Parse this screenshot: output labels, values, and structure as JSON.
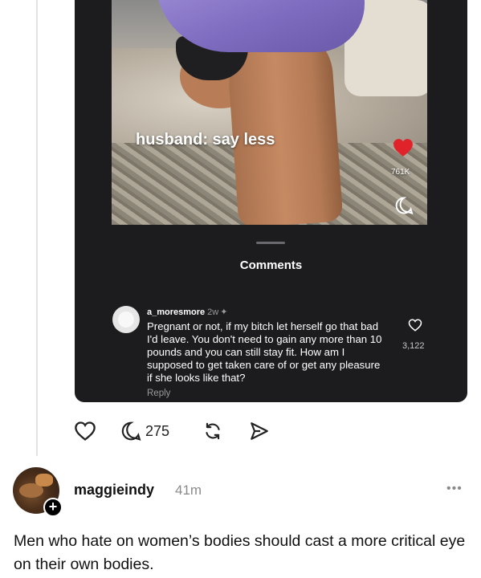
{
  "embedded_post": {
    "image_caption": "husband: say less",
    "image_like_count": "761K",
    "comments_sheet_title": "Comments",
    "comment": {
      "username": "a_moresmore",
      "time": "2w",
      "pin_icon": "pin-icon",
      "text": "Pregnant or not, if my bitch let herself go that bad I'd leave. You don't need to gain any more than 10 pounds and you can still stay fit. How am I supposed to get taken care of or get any pleasure if she looks like that?",
      "reply_label": "Reply",
      "like_count": "3,122"
    }
  },
  "actions": {
    "like_icon": "heart-icon",
    "comment_icon": "comment-icon",
    "comment_count": "275",
    "repost_icon": "repost-icon",
    "share_icon": "send-icon"
  },
  "next_post": {
    "username": "maggieindy",
    "time": "41m",
    "more_icon": "more-icon",
    "follow_icon": "plus-icon",
    "text": "Men who hate on women’s bodies should cast a more critical eye on their own bodies."
  },
  "colors": {
    "card_background": "#1c1c1e",
    "heart_red": "#e0222a",
    "muted_text": "#8a8a8a"
  }
}
